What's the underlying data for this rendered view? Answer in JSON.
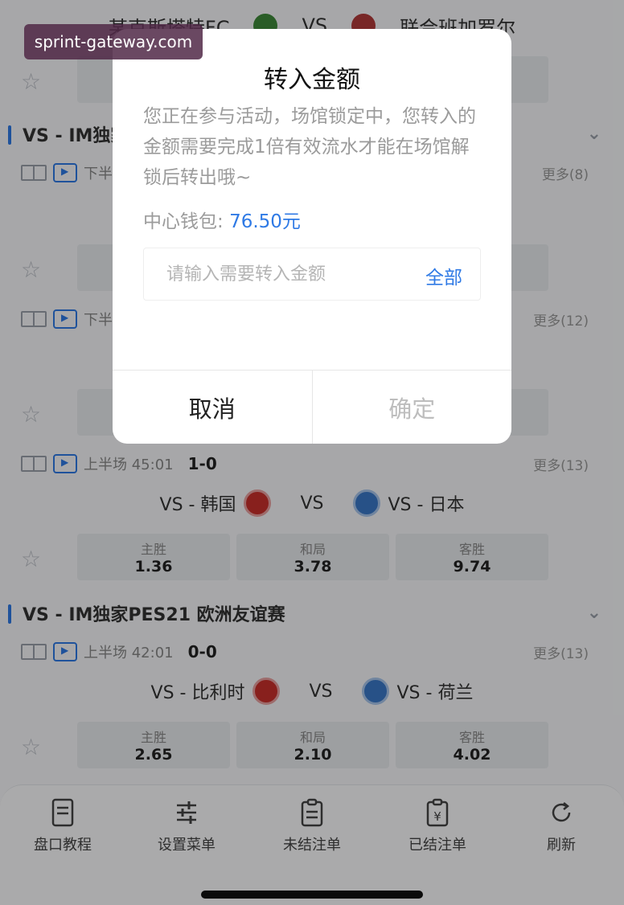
{
  "top_match": {
    "home": "某克斯塔特FC",
    "vs": "VS",
    "away": "联合班加罗尔"
  },
  "sections": [
    {
      "title": "VS - IM独家",
      "matches": [
        {
          "period": "下半",
          "more": "更多(8)"
        },
        {
          "period": "下半",
          "more": "更多(12)"
        },
        {
          "period": "上半场 45:01",
          "score": "1-0",
          "more": "更多(13)",
          "home": "VS - 韩国",
          "vs": "VS",
          "away": "VS - 日本",
          "odds": [
            {
              "label": "主胜",
              "value": "1.36"
            },
            {
              "label": "和局",
              "value": "3.78"
            },
            {
              "label": "客胜",
              "value": "9.74"
            }
          ]
        }
      ]
    },
    {
      "title": "VS - IM独家PES21 欧洲友谊赛",
      "matches": [
        {
          "period": "上半场 42:01",
          "score": "0-0",
          "more": "更多(13)",
          "home": "VS - 比利时",
          "vs": "VS",
          "away": "VS - 荷兰",
          "odds": [
            {
              "label": "主胜",
              "value": "2.65"
            },
            {
              "label": "和局",
              "value": "2.10"
            },
            {
              "label": "客胜",
              "value": "4.02"
            }
          ]
        }
      ]
    }
  ],
  "bottom_nav": [
    {
      "label": "盘口教程",
      "icon": "document-icon"
    },
    {
      "label": "设置菜单",
      "icon": "sliders-icon"
    },
    {
      "label": "未结注单",
      "icon": "clipboard-icon"
    },
    {
      "label": "已结注单",
      "icon": "yen-clipboard-icon"
    },
    {
      "label": "刷新",
      "icon": "refresh-icon"
    }
  ],
  "dialog": {
    "title": "转入金额",
    "message": "您正在参与活动，场馆锁定中，您转入的金额需要完成1倍有效流水才能在场馆解锁后转出哦~",
    "wallet_label": "中心钱包:",
    "wallet_amount": "76.50元",
    "input_placeholder": "请输入需要转入金额",
    "input_value": "",
    "all_label": "全部",
    "cancel_label": "取消",
    "confirm_label": "确定"
  },
  "watermark": "sprint-gateway.com",
  "colors": {
    "accent": "#2f7ae5",
    "home_badge": "#c9302c",
    "away_badge": "#3a78c8"
  }
}
